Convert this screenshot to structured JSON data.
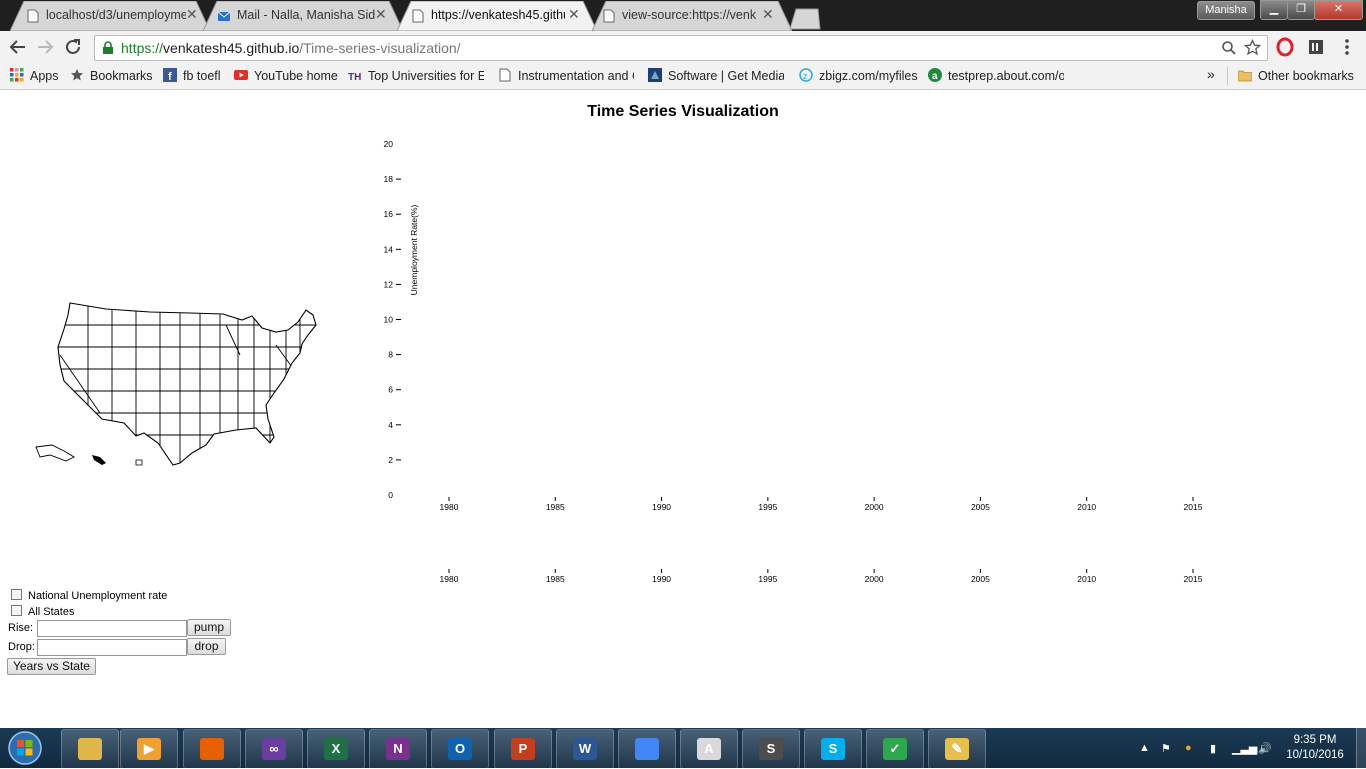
{
  "browser": {
    "tabs": [
      {
        "title": "localhost/d3/unemployme",
        "favicon": "page-icon",
        "active": false
      },
      {
        "title": "Mail - Nalla, Manisha Sid",
        "favicon": "mail-icon",
        "active": false
      },
      {
        "title": "https://venkatesh45.githu",
        "favicon": "page-icon",
        "active": true
      },
      {
        "title": "view-source:https://venk",
        "favicon": "page-icon",
        "active": false
      }
    ],
    "profile_name": "Manisha",
    "url": {
      "scheme": "https://",
      "host": "venkatesh45.github.io",
      "path": "/Time-series-visualization/"
    },
    "bookmarks": [
      {
        "label": "Apps",
        "icon": "apps-grid-icon"
      },
      {
        "label": "Bookmarks",
        "icon": "star-icon"
      },
      {
        "label": "fb toefl",
        "icon": "facebook-icon"
      },
      {
        "label": "YouTube home",
        "icon": "youtube-icon"
      },
      {
        "label": "Top Universities for Er",
        "icon": "the-icon"
      },
      {
        "label": "Instrumentation and C",
        "icon": "page-icon"
      },
      {
        "label": "Software | Get Media",
        "icon": "software-icon"
      },
      {
        "label": "zbigz.com/myfiles",
        "icon": "zbigz-icon"
      },
      {
        "label": "testprep.about.com/o",
        "icon": "about-icon"
      }
    ],
    "bookmarks_overflow": "»",
    "other_bookmarks": "Other bookmarks"
  },
  "page": {
    "title": "Time Series Visualization",
    "controls": {
      "national_label": "National Unemployment rate",
      "all_states_label": "All States",
      "rise_label": "Rise:",
      "rise_value": "",
      "pump_label": "pump",
      "drop_label": "Drop:",
      "drop_value": "",
      "drop_button_label": "drop",
      "years_vs_state_label": "Years vs State"
    }
  },
  "chart_data": {
    "type": "line",
    "title": "",
    "ylabel": "Unemployment Rate(%)",
    "xlabel": "",
    "ylim": [
      0,
      20
    ],
    "y_ticks": [
      0,
      2,
      4,
      6,
      8,
      10,
      12,
      14,
      16,
      18,
      20
    ],
    "x_ticks": [
      1980,
      1985,
      1990,
      1995,
      2000,
      2005,
      2010,
      2015
    ],
    "brush_axis_ticks": [
      1980,
      1985,
      1990,
      1995,
      2000,
      2005,
      2010,
      2015
    ],
    "series": []
  },
  "taskbar": {
    "apps": [
      {
        "icon": "file-explorer-icon",
        "color": "#e0b64a",
        "glyph": ""
      },
      {
        "icon": "media-player-icon",
        "color": "#f0a030",
        "glyph": "▶"
      },
      {
        "icon": "firefox-icon",
        "color": "#e66000",
        "glyph": ""
      },
      {
        "icon": "visual-studio-icon",
        "color": "#6a3e9e",
        "glyph": "∞"
      },
      {
        "icon": "excel-icon",
        "color": "#1e7145",
        "glyph": "X"
      },
      {
        "icon": "onenote-icon",
        "color": "#7b2f8e",
        "glyph": "N"
      },
      {
        "icon": "outlook-icon",
        "color": "#0f62b0",
        "glyph": "O"
      },
      {
        "icon": "powerpoint-icon",
        "color": "#c43e1c",
        "glyph": "P"
      },
      {
        "icon": "word-icon",
        "color": "#2b5797",
        "glyph": "W"
      },
      {
        "icon": "chrome-icon",
        "color": "#4285f4",
        "glyph": ""
      },
      {
        "icon": "text-editor-icon",
        "color": "#d9d9d9",
        "glyph": "A"
      },
      {
        "icon": "sublime-icon",
        "color": "#4d4d4d",
        "glyph": "S"
      },
      {
        "icon": "skype-icon",
        "color": "#00aff0",
        "glyph": "S"
      },
      {
        "icon": "security-shield-icon",
        "color": "#2da84a",
        "glyph": "✓"
      },
      {
        "icon": "paint-icon",
        "color": "#e7c04b",
        "glyph": "✎"
      }
    ],
    "time": "9:35 PM",
    "date": "10/10/2016"
  }
}
